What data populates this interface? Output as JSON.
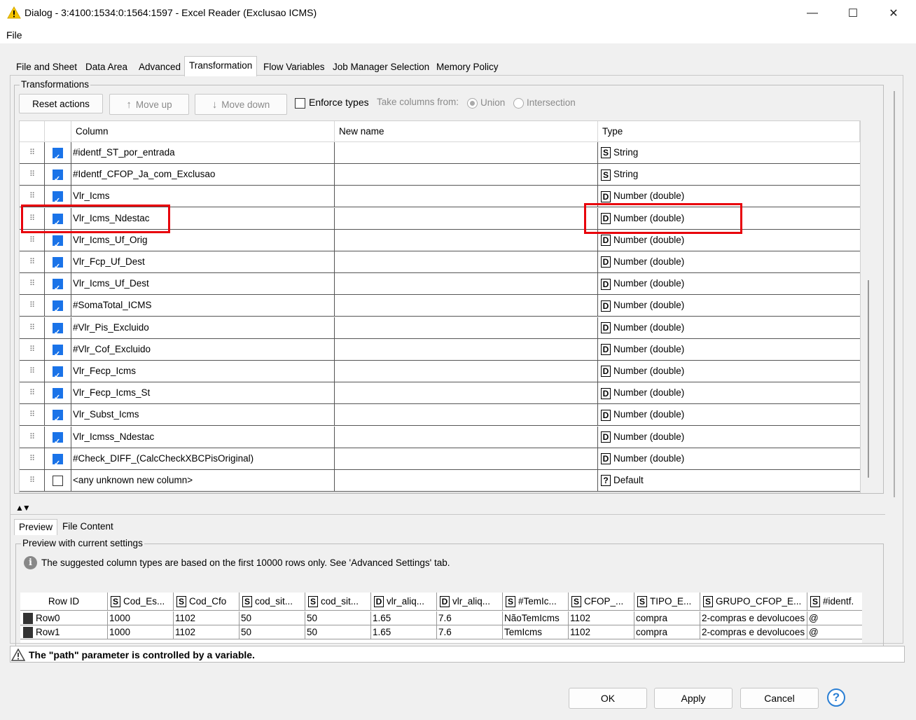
{
  "window": {
    "title": "Dialog - 3:4100:1534:0:1564:1597 - Excel Reader (Exclusao ICMS)",
    "minimize": "—",
    "maximize": "☐",
    "close": "✕"
  },
  "menu": {
    "file": "File"
  },
  "tabs": [
    "File and Sheet",
    "Data Area",
    "Advanced",
    "Transformation",
    "Flow Variables",
    "Job Manager Selection",
    "Memory Policy"
  ],
  "active_tab": "Transformation",
  "transformations": {
    "group_label": "Transformations",
    "reset_actions": "Reset actions",
    "move_up": "Move up",
    "move_down": "Move down",
    "enforce_types": "Enforce types",
    "take_columns_from": "Take columns from:",
    "union": "Union",
    "intersection": "Intersection",
    "headers": {
      "column": "Column",
      "new_name": "New name",
      "type": "Type"
    },
    "rows": [
      {
        "checked": true,
        "column": "#identf_ST_por_entrada",
        "new_name": "",
        "type_code": "S",
        "type": "String"
      },
      {
        "checked": true,
        "column": "#Identf_CFOP_Ja_com_Exclusao",
        "new_name": "",
        "type_code": "S",
        "type": "String"
      },
      {
        "checked": true,
        "column": "Vlr_Icms",
        "new_name": "",
        "type_code": "D",
        "type": "Number (double)"
      },
      {
        "checked": true,
        "column": "Vlr_Icms_Ndestac",
        "new_name": "",
        "type_code": "D",
        "type": "Number (double)"
      },
      {
        "checked": true,
        "column": "Vlr_Icms_Uf_Orig",
        "new_name": "",
        "type_code": "D",
        "type": "Number (double)"
      },
      {
        "checked": true,
        "column": "Vlr_Fcp_Uf_Dest",
        "new_name": "",
        "type_code": "D",
        "type": "Number (double)"
      },
      {
        "checked": true,
        "column": "Vlr_Icms_Uf_Dest",
        "new_name": "",
        "type_code": "D",
        "type": "Number (double)"
      },
      {
        "checked": true,
        "column": "#SomaTotal_ICMS",
        "new_name": "",
        "type_code": "D",
        "type": "Number (double)"
      },
      {
        "checked": true,
        "column": "#Vlr_Pis_Excluido",
        "new_name": "",
        "type_code": "D",
        "type": "Number (double)"
      },
      {
        "checked": true,
        "column": "#Vlr_Cof_Excluido",
        "new_name": "",
        "type_code": "D",
        "type": "Number (double)"
      },
      {
        "checked": true,
        "column": "Vlr_Fecp_Icms",
        "new_name": "",
        "type_code": "D",
        "type": "Number (double)"
      },
      {
        "checked": true,
        "column": "Vlr_Fecp_Icms_St",
        "new_name": "",
        "type_code": "D",
        "type": "Number (double)"
      },
      {
        "checked": true,
        "column": "Vlr_Subst_Icms",
        "new_name": "",
        "type_code": "D",
        "type": "Number (double)"
      },
      {
        "checked": true,
        "column": "Vlr_Icmss_Ndestac",
        "new_name": "",
        "type_code": "D",
        "type": "Number (double)"
      },
      {
        "checked": true,
        "column": "#Check_DIFF_(CalcCheckXBCPisOriginal)",
        "new_name": "",
        "type_code": "D",
        "type": "Number (double)"
      },
      {
        "checked": false,
        "column": "<any unknown new column>",
        "new_name": "",
        "type_code": "?",
        "type": "Default"
      }
    ]
  },
  "preview": {
    "tabs": [
      "Preview",
      "File Content"
    ],
    "group_label": "Preview with current settings",
    "info": "The suggested column types are based on the first 10000 rows only. See 'Advanced Settings' tab.",
    "rowid_header": "Row ID",
    "columns": [
      {
        "code": "S",
        "name": "Cod_Es..."
      },
      {
        "code": "S",
        "name": "Cod_Cfo"
      },
      {
        "code": "S",
        "name": "cod_sit..."
      },
      {
        "code": "S",
        "name": "cod_sit..."
      },
      {
        "code": "D",
        "name": "vlr_aliq..."
      },
      {
        "code": "D",
        "name": "vlr_aliq..."
      },
      {
        "code": "S",
        "name": "#TemIc..."
      },
      {
        "code": "S",
        "name": "CFOP_..."
      },
      {
        "code": "S",
        "name": "TIPO_E..."
      },
      {
        "code": "S",
        "name": "GRUPO_CFOP_E..."
      },
      {
        "code": "S",
        "name": "#identf."
      }
    ],
    "rows": [
      {
        "id": "Row0",
        "cells": [
          "1000",
          "1102",
          "50",
          "50",
          "1.65",
          "7.6",
          "NãoTemIcms",
          "1102",
          "compra",
          "2-compras e devolucoes",
          "@"
        ]
      },
      {
        "id": "Row1",
        "cells": [
          "1000",
          "1102",
          "50",
          "50",
          "1.65",
          "7.6",
          "TemIcms",
          "1102",
          "compra",
          "2-compras e devolucoes",
          "@"
        ]
      }
    ]
  },
  "status": "The \"path\" parameter is controlled by a variable.",
  "buttons": {
    "ok": "OK",
    "apply": "Apply",
    "cancel": "Cancel",
    "help": "?"
  }
}
